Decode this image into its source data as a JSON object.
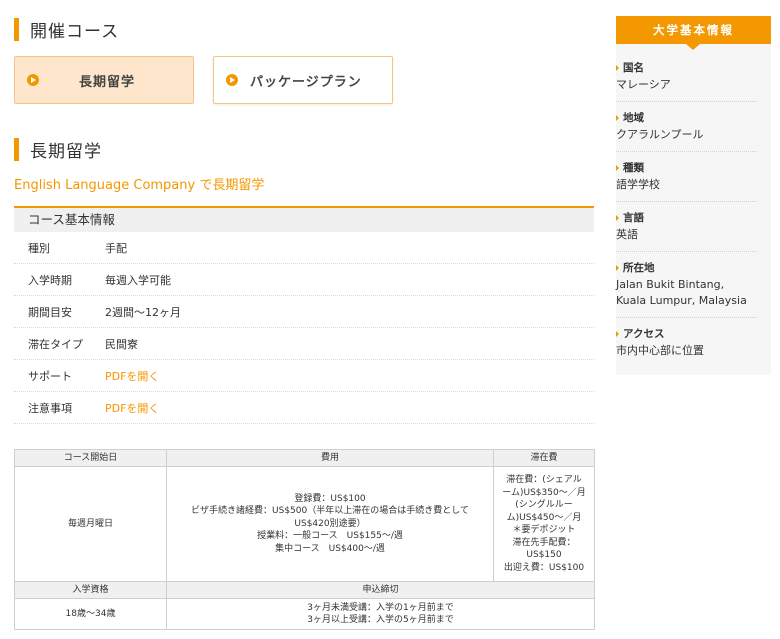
{
  "main": {
    "course_heading": "開催コース",
    "tabs": [
      {
        "label": "長期留学"
      },
      {
        "label": "パッケージプラン"
      }
    ],
    "section_heading": "長期留学",
    "subtitle": "English Language Company で長期留学",
    "info_title": "コース基本情報",
    "info_rows": [
      {
        "key": "種別",
        "value": "手配"
      },
      {
        "key": "入学時期",
        "value": "毎週入学可能"
      },
      {
        "key": "期間目安",
        "value": "2週間～12ヶ月"
      },
      {
        "key": "滞在タイプ",
        "value": "民間寮"
      },
      {
        "key": "サポート",
        "value": "PDFを開く"
      },
      {
        "key": "注意事項",
        "value": "PDFを開く"
      }
    ]
  },
  "fee_table": {
    "headers": {
      "start": "コース開始日",
      "fee": "費用",
      "stay": "滞在費"
    },
    "start_value": "毎週月曜日",
    "fee_value": "登録費：US$100\nビザ手続き諸経費：US$500（半年以上滞在の場合は手続き費として\nUS$420別途要）\n授業料：一般コース　US$155～/週\n集中コース　US$400～/週",
    "stay_value": "滞在費：(シェアル\nーム)US$350～／月\n(シングルルー\nム)US$450～／月\n＊要デポジット\n滞在先手配費：\nUS$150\n出迎え費：US$100",
    "headers2": {
      "qual": "入学資格",
      "deadline": "申込締切"
    },
    "qual_value": "18歳～34歳",
    "deadline_value": "3ヶ月未満受講：入学の1ヶ月前まで\n3ヶ月以上受講：入学の5ヶ月前まで"
  },
  "sidebar": {
    "title": "大学基本情報",
    "items": [
      {
        "label": "国名",
        "value": "マレーシア"
      },
      {
        "label": "地域",
        "value": "クアラルンプール"
      },
      {
        "label": "種類",
        "value": "語学学校"
      },
      {
        "label": "言語",
        "value": "英語"
      },
      {
        "label": "所在地",
        "value": "Jalan Bukit Bintang,\nKuala Lumpur, Malaysia"
      },
      {
        "label": "アクセス",
        "value": "市内中心部に位置"
      }
    ]
  }
}
